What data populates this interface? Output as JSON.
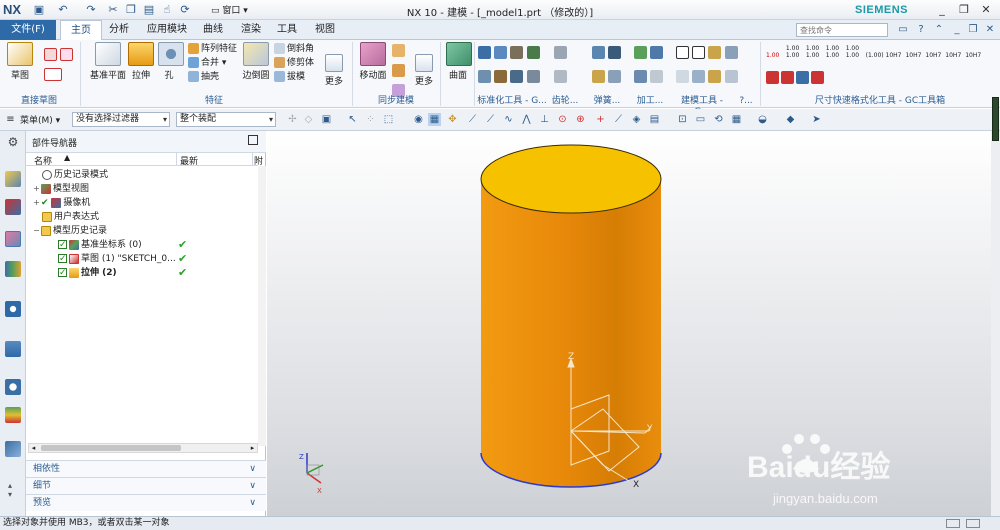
{
  "title_bar": {
    "logo": "NX",
    "window_title": "NX 10 - 建模 - [_model1.prt （修改的）]",
    "brand": "SIEMENS",
    "window_menu": "窗口"
  },
  "tabs": {
    "file": "文件(F)",
    "items": [
      "主页",
      "分析",
      "应用模块",
      "曲线",
      "渲染",
      "工具",
      "视图"
    ],
    "active": "主页",
    "search_placeholder": "查找命令"
  },
  "ribbon": {
    "direct_sketch": {
      "sketch": "草图",
      "group": "直接草图"
    },
    "feature": {
      "datum_plane": "基准平面",
      "extrude": "拉伸",
      "hole": "孔",
      "pattern_feature": "阵列特征",
      "combine": "合并",
      "shell": "抽壳",
      "edge_blend": "边倒圆",
      "chamfer": "倒斜角",
      "trim_body": "修剪体",
      "draft": "拔模",
      "more": "更多",
      "group": "特征"
    },
    "sync_modeling": {
      "move_face": "移动面",
      "more": "更多",
      "group": "同步建模"
    },
    "surface": {
      "label": "曲面"
    },
    "groups_right": [
      "标准化工具 - G...",
      "齿轮...",
      "弹簧...",
      "加工...",
      "建模工具 - G...",
      "?...",
      "尺寸快速格式化工具 - GC工具箱"
    ],
    "dim_labels": [
      "1.00",
      "1.00\n1.00",
      "1.00\n1.00",
      "1.00\n1.00",
      "1.00\n1.00",
      "(1.00)",
      "10H7",
      "10H7",
      "10H7",
      "10H7",
      "10H7"
    ]
  },
  "toolbar": {
    "menu": "菜单(M)",
    "filter": "没有选择过滤器",
    "assembly": "整个装配"
  },
  "navigator": {
    "title": "部件导航器",
    "col_name": "名称",
    "col_latest": "最新",
    "col_extra": "附",
    "rows": [
      {
        "label": "历史记录模式",
        "indent": 1,
        "latest": ""
      },
      {
        "label": "模型视图",
        "indent": 1,
        "latest": ""
      },
      {
        "label": "摄像机",
        "indent": 1,
        "latest": ""
      },
      {
        "label": "用户表达式",
        "indent": 1,
        "latest": ""
      },
      {
        "label": "模型历史记录",
        "indent": 1,
        "latest": ""
      },
      {
        "label": "基准坐标系 (0)",
        "indent": 2,
        "latest": "✔"
      },
      {
        "label": "草图 (1) \"SKETCH_0...",
        "indent": 2,
        "latest": "✔"
      },
      {
        "label": "拉伸 (2)",
        "indent": 2,
        "latest": "✔"
      }
    ],
    "panels": [
      "相依性",
      "细节",
      "预览"
    ]
  },
  "viewport": {
    "axis_z": "Z",
    "axis_y": "Y",
    "axis_x": "X",
    "watermark_main": "Baidu经验",
    "watermark_url": "jingyan.baidu.com",
    "cylinder_top_color": "#f6c200",
    "cylinder_side_color": "#e9870a"
  },
  "status_bar": {
    "message": "选择对象并使用 MB3，或者双击某一对象"
  }
}
